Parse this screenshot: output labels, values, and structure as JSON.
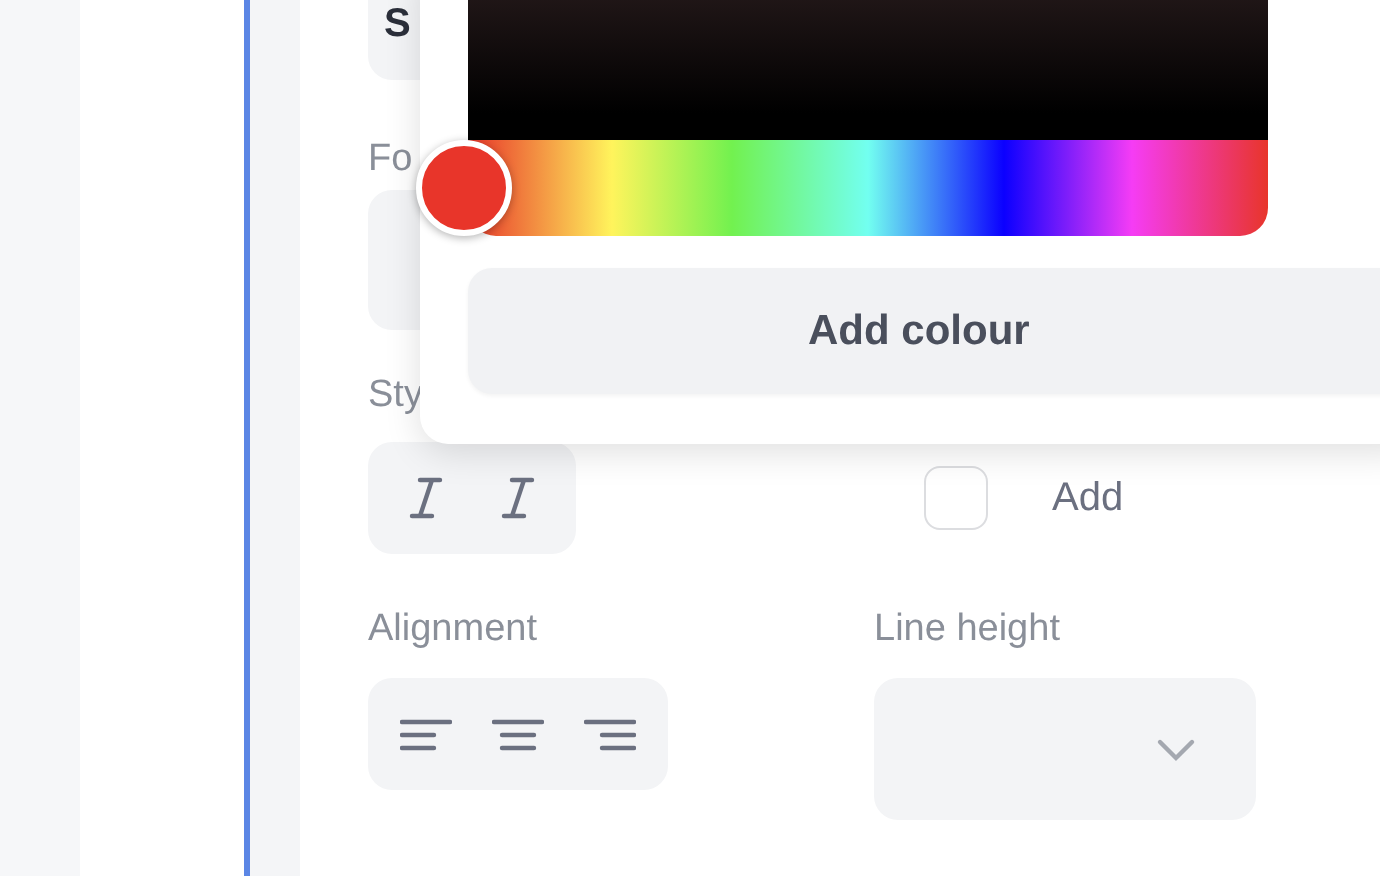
{
  "top_field": {
    "value": "S"
  },
  "font": {
    "label": "Fo"
  },
  "styles": {
    "label": "Sty",
    "buttons": [
      {
        "kind": "italic",
        "selected": false
      },
      {
        "kind": "italic",
        "selected": false
      }
    ]
  },
  "add_option": {
    "label": "Add",
    "checked": false
  },
  "alignment": {
    "label": "Alignment",
    "options": [
      {
        "kind": "left",
        "selected": false
      },
      {
        "kind": "center",
        "selected": false
      },
      {
        "kind": "right",
        "selected": false
      }
    ]
  },
  "line_height": {
    "label": "Line height"
  },
  "colour_picker": {
    "hue": {
      "level": 0
    },
    "button": "Add colour"
  }
}
